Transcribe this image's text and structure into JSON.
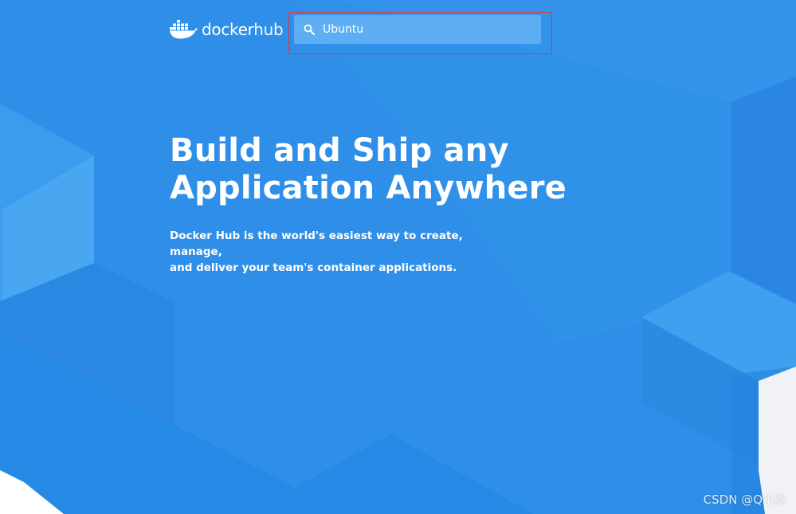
{
  "header": {
    "logo_text_left": "docker",
    "logo_text_right": "hub"
  },
  "search": {
    "value": "Ubuntu",
    "icon": "search-icon"
  },
  "hero": {
    "title_line1": "Build and Ship any",
    "title_line2": "Application Anywhere",
    "subtitle_line1": "Docker Hub is the world's easiest way to create, manage,",
    "subtitle_line2": "and deliver your team's container applications."
  },
  "watermark": "CSDN @Q小鑫",
  "colors": {
    "background": "#2f8fe8",
    "search_bg": "#5daef2",
    "highlight": "#d93b3b"
  }
}
